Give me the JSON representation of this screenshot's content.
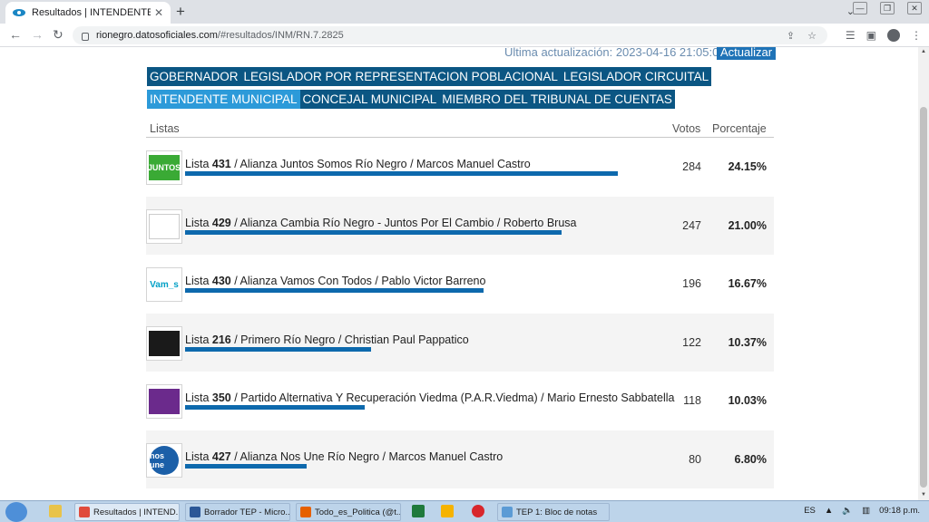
{
  "browser": {
    "tab_title": "Resultados | INTENDENTE MUNI",
    "tab_close": "✕",
    "new_tab": "+",
    "tab_menu": "⌄",
    "url_host": "rionegro.datosoficiales.com",
    "url_path": "/#resultados/INM/RN.7.2825",
    "win_min": "—",
    "win_max": "❐",
    "win_close": "✕"
  },
  "page": {
    "update_label": "Última actualización: 2023-04-16 21:05:02",
    "update_button": "Actualizar",
    "categories_row1": [
      "GOBERNADOR",
      "LEGISLADOR POR REPRESENTACION POBLACIONAL",
      "LEGISLADOR CIRCUITAL"
    ],
    "categories_row2": [
      "INTENDENTE MUNICIPAL",
      "CONCEJAL MUNICIPAL",
      "MIEMBRO DEL TRIBUNAL DE CUENTAS"
    ],
    "active_category": "INTENDENTE MUNICIPAL",
    "header": {
      "lists": "Listas",
      "votes": "Votos",
      "percent": "Porcentaje"
    },
    "rows": [
      {
        "prefix": "Lista ",
        "number": "431",
        "name": " / Alianza Juntos Somos Río Negro / Marcos Manuel Castro",
        "votes": "284",
        "percent": "24.15%",
        "share": 24.15,
        "logo": "JUNTOS",
        "logo_color": "#3aaa35"
      },
      {
        "prefix": "Lista ",
        "number": "429",
        "name": " / Alianza Cambia Río Negro - Juntos Por El Cambio / Roberto Brusa",
        "votes": "247",
        "percent": "21.00%",
        "share": 21.0,
        "logo": "",
        "logo_color": "#ffffff"
      },
      {
        "prefix": "Lista ",
        "number": "430",
        "name": " / Alianza Vamos Con Todos / Pablo Victor Barreno",
        "votes": "196",
        "percent": "16.67%",
        "share": 16.67,
        "logo": "Vam_s",
        "logo_color": "#00a0c6"
      },
      {
        "prefix": "Lista ",
        "number": "216",
        "name": " / Primero Río Negro / Christian Paul Pappatico",
        "votes": "122",
        "percent": "10.37%",
        "share": 10.37,
        "logo": "",
        "logo_color": "#1a1a1a"
      },
      {
        "prefix": "Lista ",
        "number": "350",
        "name": " / Partido Alternativa Y Recuperación Viedma (P.A.R.Viedma) / Mario Ernesto Sabbatella",
        "votes": "118",
        "percent": "10.03%",
        "share": 10.03,
        "logo": "",
        "logo_color": "#6b2a8c"
      },
      {
        "prefix": "Lista ",
        "number": "427",
        "name": " / Alianza Nos Une Río Negro / Marcos Manuel Castro",
        "votes": "80",
        "percent": "6.80%",
        "share": 6.8,
        "logo": "nos une",
        "logo_color": "#1b5fa8"
      }
    ]
  },
  "taskbar": {
    "items": [
      {
        "label": "Resultados | INTEND...",
        "color": "#e04b3c"
      },
      {
        "label": "Borrador TEP - Micro...",
        "color": "#2b5797"
      },
      {
        "label": "Todo_es_Politica (@t...",
        "color": "#e66000"
      },
      {
        "label": "TEP 1: Bloc de notas",
        "color": "#5b9bd5"
      }
    ],
    "lang": "ES",
    "time": "09:18 p.m."
  }
}
